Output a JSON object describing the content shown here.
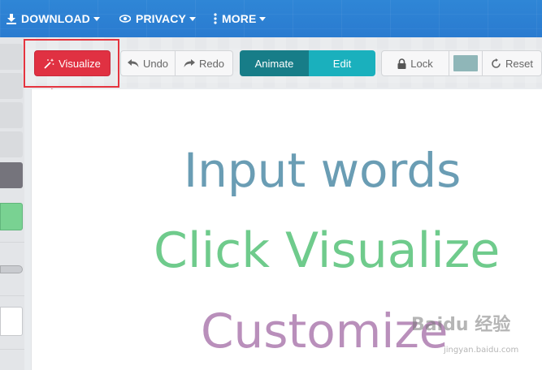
{
  "topbar": {
    "download_label": "DOWNLOAD",
    "privacy_label": "PRIVACY",
    "more_label": "MORE"
  },
  "toolbar": {
    "visualize_label": "Visualize",
    "undo_label": "Undo",
    "redo_label": "Redo",
    "animate_label": "Animate",
    "edit_label": "Edit",
    "lock_label": "Lock",
    "reset_label": "Reset",
    "color_swatch": "#8fb6b8"
  },
  "canvas": {
    "words": [
      {
        "text": "Input words",
        "color": "#6a9db4"
      },
      {
        "text": "Click Visualize",
        "color": "#6fcb8c"
      },
      {
        "text": "Customize",
        "color": "#b98fbb"
      }
    ]
  },
  "watermark": {
    "text": "Baidu 经验",
    "subtext": "jingyan.baidu.com"
  },
  "colors": {
    "topbar": "#2f86d6",
    "visualize": "#e03142",
    "animate": "#177d88",
    "edit": "#1ab0bd",
    "annotation": "#e5343f"
  }
}
